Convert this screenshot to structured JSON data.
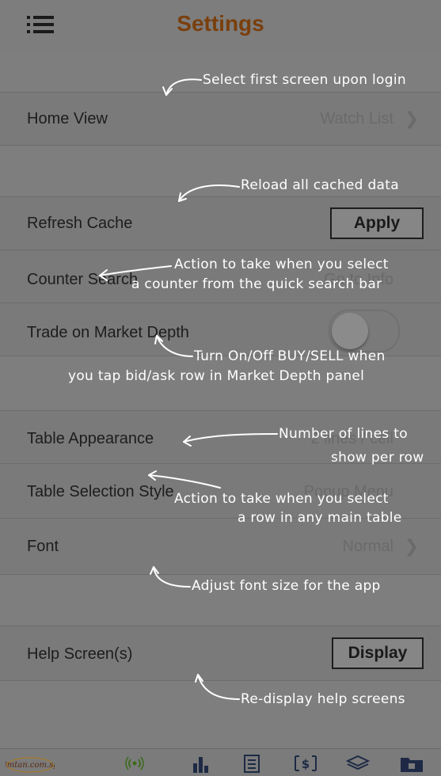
{
  "header": {
    "title": "Settings"
  },
  "rows": {
    "home_view": {
      "label": "Home View",
      "value": "Watch List"
    },
    "refresh_cache": {
      "label": "Refresh Cache",
      "button": "Apply"
    },
    "counter_search": {
      "label": "Counter Search",
      "value": "Go to Info"
    },
    "trade_market_depth": {
      "label": "Trade on Market Depth",
      "toggle": "off"
    },
    "table_appearance": {
      "label": "Table Appearance",
      "value": "2 lines / cell"
    },
    "table_selection_style": {
      "label": "Table Selection Style",
      "value": "Popup Menu"
    },
    "font": {
      "label": "Font",
      "value": "Normal"
    },
    "help_screens": {
      "label": "Help Screen(s)",
      "button": "Display"
    }
  },
  "annotations": {
    "home_view": "Select first screen upon login",
    "refresh_cache": "Reload all cached data",
    "counter_search_1": "Action to take when you select",
    "counter_search_2": "a counter from the quick search bar",
    "trade_1": "Turn On/Off BUY/SELL when",
    "trade_2": "you tap bid/ask row in Market Depth panel",
    "appearance_1": "Number of lines to",
    "appearance_2": "show per row",
    "selection_1": "Action to take when you select",
    "selection_2": "a row in any main table",
    "font": "Adjust font size for the app",
    "help": "Re-display help screens"
  },
  "tabbar": {
    "logo_text": "limtan.com.sg",
    "icons": [
      "limtan-logo",
      "signal-icon",
      "chart-icon",
      "document-icon",
      "currency-icon",
      "layers-icon",
      "portfolio-icon"
    ]
  },
  "colors": {
    "title": "#7a3f0c",
    "annotation": "#ffffff",
    "overlay": "#7e7e7e"
  }
}
